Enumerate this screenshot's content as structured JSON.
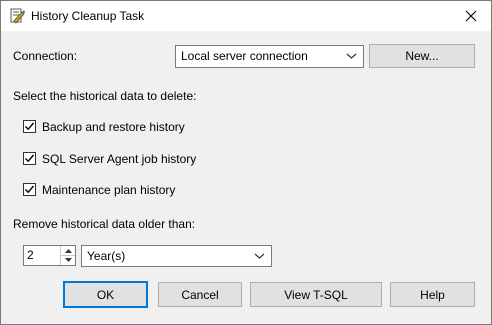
{
  "window": {
    "title": "History Cleanup Task"
  },
  "connection": {
    "label": "Connection:",
    "selected": "Local server connection",
    "new_button": "New..."
  },
  "history": {
    "section_label": "Select the historical data to delete:",
    "items": [
      {
        "label": "Backup and restore history",
        "checked": true
      },
      {
        "label": "SQL Server Agent job history",
        "checked": true
      },
      {
        "label": "Maintenance plan history",
        "checked": true
      }
    ]
  },
  "age": {
    "label": "Remove historical data older than:",
    "value": "2",
    "unit": "Year(s)"
  },
  "buttons": {
    "ok": "OK",
    "cancel": "Cancel",
    "view_tsql": "View T-SQL",
    "help": "Help"
  },
  "icons": {
    "title": "history-cleanup-task-icon",
    "close": "close-icon",
    "dropdown": "chevron-down-icon",
    "check": "checkmark-icon",
    "spin_up": "arrow-up-icon",
    "spin_down": "arrow-down-icon"
  },
  "colors": {
    "default_button_border": "#0078d7",
    "dialog_background": "#f0f0f0"
  }
}
